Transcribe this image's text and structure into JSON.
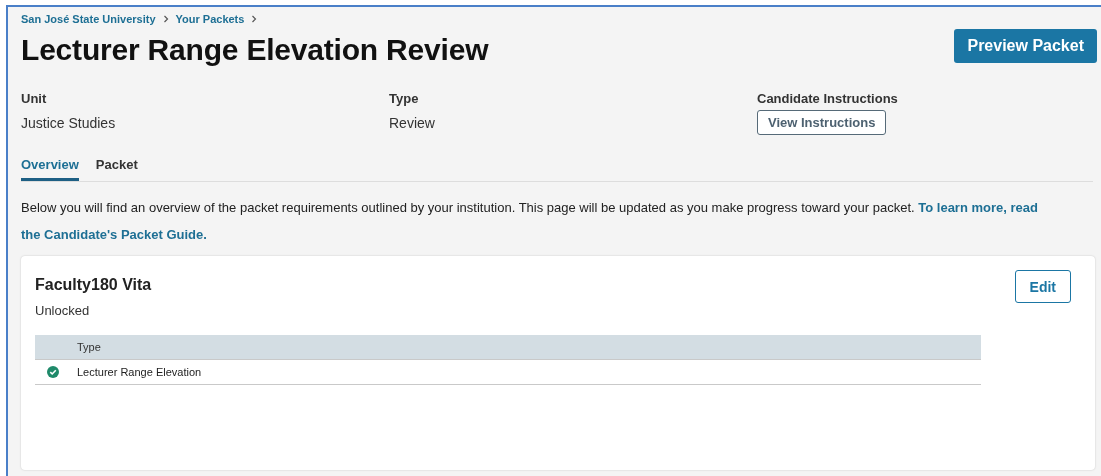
{
  "breadcrumbs": [
    {
      "label": "San José State University"
    },
    {
      "label": "Your Packets"
    }
  ],
  "title": "Lecturer Range Elevation Review",
  "actions": {
    "primary": "Preview Packet"
  },
  "details": [
    {
      "label": "Unit",
      "value": "Justice Studies",
      "kind": "text"
    },
    {
      "label": "Type",
      "value": "Review",
      "kind": "text"
    },
    {
      "label": "Candidate Instructions",
      "value": "View Instructions",
      "kind": "button"
    }
  ],
  "tabs": [
    {
      "label": "Overview",
      "selected": true
    },
    {
      "label": "Packet",
      "selected": false
    }
  ],
  "intro": {
    "text": "Below you will find an overview of the packet requirements outlined by your institution. This page will be updated as you make progress toward your packet.",
    "link_lines": [
      "To learn more, read",
      "the Candidate's Packet Guide."
    ]
  },
  "sections": [
    {
      "title": "Faculty180 Vita",
      "status": "Unlocked",
      "button": "Edit",
      "table": {
        "columns": [
          "Type"
        ],
        "rows": [
          {
            "complete": true,
            "cells": [
              "Lecturer Range Elevation"
            ]
          }
        ]
      }
    }
  ]
}
